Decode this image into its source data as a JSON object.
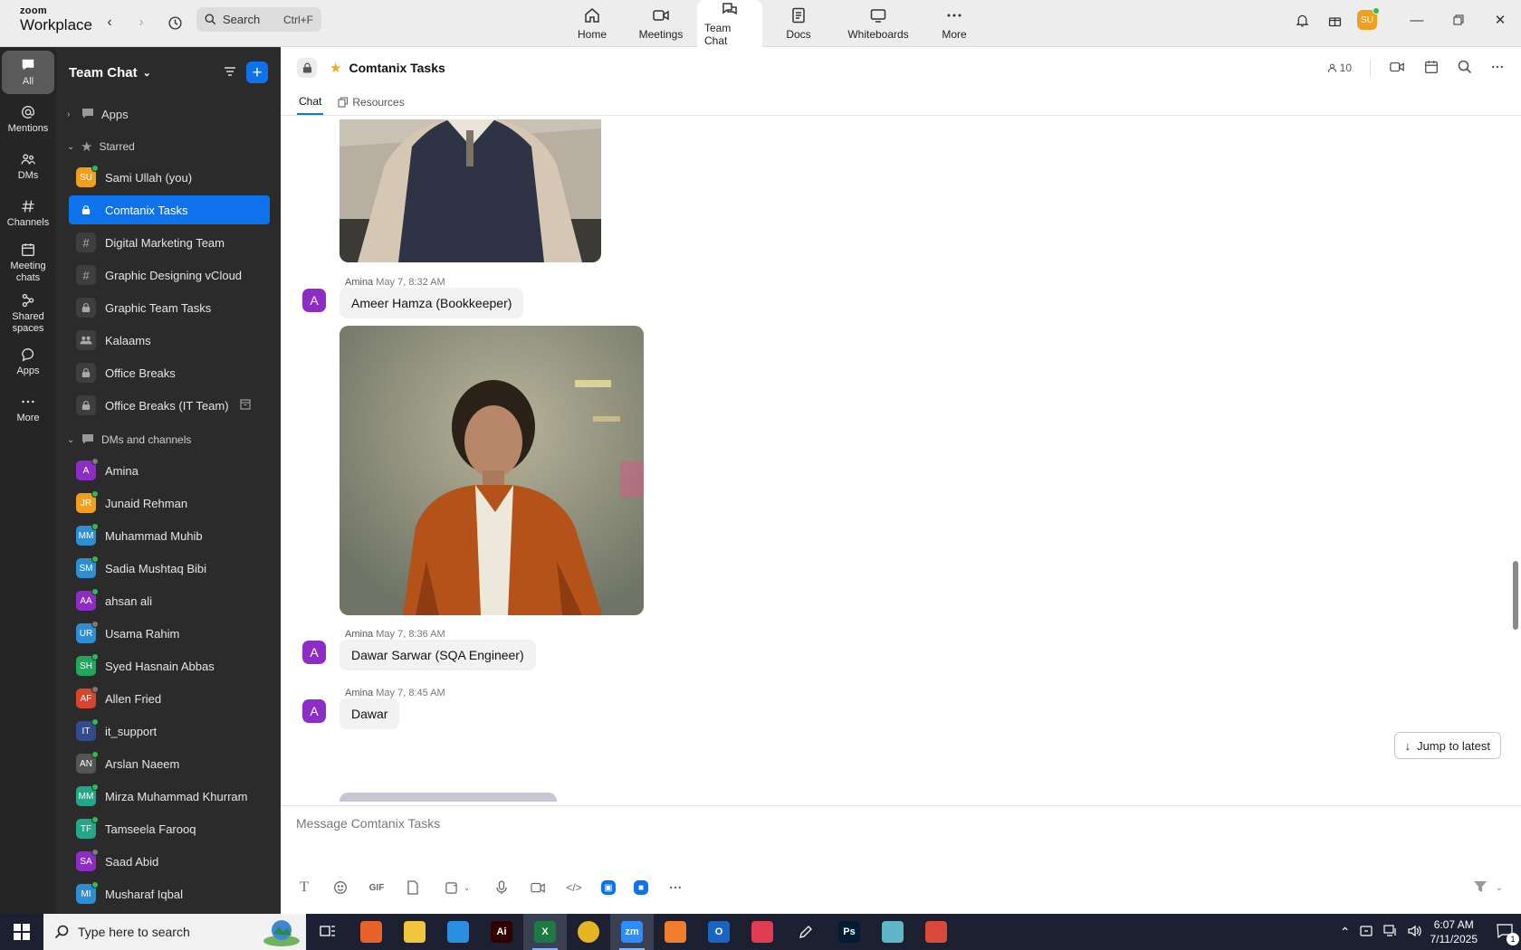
{
  "app": {
    "brand_top": "zoom",
    "brand_bottom": "Workplace"
  },
  "search": {
    "placeholder": "Search",
    "shortcut": "Ctrl+F"
  },
  "nav_tabs": [
    {
      "label": "Home",
      "icon": "home-icon"
    },
    {
      "label": "Meetings",
      "icon": "video-icon"
    },
    {
      "label": "Team Chat",
      "icon": "chat-icon",
      "active": true
    },
    {
      "label": "Docs",
      "icon": "doc-icon"
    },
    {
      "label": "Whiteboards",
      "icon": "whiteboard-icon"
    },
    {
      "label": "More",
      "icon": "more-icon"
    }
  ],
  "user": {
    "initials": "SU",
    "color": "#f0a01c"
  },
  "rail": [
    {
      "label": "All",
      "active": true
    },
    {
      "label": "Mentions"
    },
    {
      "label": "DMs"
    },
    {
      "label": "Channels"
    },
    {
      "label": "Meeting chats"
    },
    {
      "label": "Shared spaces"
    },
    {
      "label": "Apps"
    },
    {
      "label": "More"
    }
  ],
  "sidebar": {
    "title": "Team Chat",
    "sections": {
      "apps": "Apps",
      "starred": "Starred",
      "dms": "DMs and channels"
    },
    "starred": [
      {
        "label": "Sami Ullah (you)",
        "type": "avatar",
        "initials": "SU",
        "color": "#f0a01c",
        "status": "on"
      },
      {
        "label": "Comtanix Tasks",
        "type": "lock",
        "active": true
      },
      {
        "label": "Digital Marketing Team",
        "type": "hash"
      },
      {
        "label": "Graphic Designing vCloud",
        "type": "hash"
      },
      {
        "label": "Graphic Team Tasks",
        "type": "lock"
      },
      {
        "label": "Kalaams",
        "type": "group"
      },
      {
        "label": "Office Breaks",
        "type": "lock"
      },
      {
        "label": "Office Breaks (IT Team)",
        "type": "lock",
        "trail": "archive"
      }
    ],
    "dms": [
      {
        "label": "Amina",
        "initials": "A",
        "color": "#8e2dc5",
        "status": "off"
      },
      {
        "label": "Junaid Rehman",
        "initials": "JR",
        "color": "#f0a01c",
        "status": "on"
      },
      {
        "label": "Muhammad Muhib",
        "initials": "MM",
        "color": "#2d8ed2",
        "status": "on"
      },
      {
        "label": "Sadia Mushtaq Bibi",
        "initials": "SM",
        "color": "#2d8ed2",
        "status": "on"
      },
      {
        "label": "ahsan ali",
        "initials": "AA",
        "color": "#8e2dc5",
        "status": "on"
      },
      {
        "label": "Usama Rahim",
        "initials": "UR",
        "color": "#2d8ed2",
        "status": "off"
      },
      {
        "label": "Syed Hasnain Abbas",
        "initials": "SH",
        "color": "#24a65c",
        "status": "on"
      },
      {
        "label": "Allen Fried",
        "initials": "AF",
        "color": "#d8452a",
        "status": "off"
      },
      {
        "label": "it_support",
        "initials": "IT",
        "color": "#334a8c",
        "status": "on"
      },
      {
        "label": "Arslan Naeem",
        "initials": "AN",
        "color": "#555555",
        "status": "on"
      },
      {
        "label": "Mirza Muhammad Khurram",
        "initials": "MM",
        "color": "#24a68a",
        "status": "on"
      },
      {
        "label": "Tamseela Farooq",
        "initials": "TF",
        "color": "#24a68a",
        "status": "on"
      },
      {
        "label": "Saad Abid",
        "initials": "SA",
        "color": "#8e2dc5",
        "status": "off"
      },
      {
        "label": "Musharaf Iqbal",
        "initials": "MI",
        "color": "#2d8ed2",
        "status": "on"
      }
    ]
  },
  "channel": {
    "name": "Comtanix Tasks",
    "member_count": "10",
    "tabs": {
      "chat": "Chat",
      "resources": "Resources"
    }
  },
  "messages": [
    {
      "sender": "Amina",
      "time": "May 7, 8:32 AM",
      "text": "Ameer Hamza (Bookkeeper)",
      "avatar": "A"
    },
    {
      "sender": "Amina",
      "time": "May 7, 8:36 AM",
      "text": "Dawar Sarwar (SQA Engineer)",
      "avatar": "A"
    },
    {
      "sender": "Amina",
      "time": "May 7, 8:45 AM",
      "text": "Dawar",
      "avatar": "A"
    }
  ],
  "jump_label": "Jump to latest",
  "composer": {
    "placeholder": "Message Comtanix Tasks",
    "gif": "GIF"
  },
  "taskbar": {
    "search_placeholder": "Type here to search",
    "time": "6:07 AM",
    "date": "7/11/2025",
    "notif_count": "1",
    "apps": [
      {
        "name": "task-view",
        "label": ""
      },
      {
        "name": "firefox",
        "label": ""
      },
      {
        "name": "file-explorer",
        "label": ""
      },
      {
        "name": "vscode",
        "label": ""
      },
      {
        "name": "illustrator",
        "label": "Ai"
      },
      {
        "name": "excel",
        "label": "X"
      },
      {
        "name": "chrome",
        "label": ""
      },
      {
        "name": "zoom",
        "label": "zm"
      },
      {
        "name": "xampp",
        "label": ""
      },
      {
        "name": "outlook",
        "label": "O"
      },
      {
        "name": "creative-cloud",
        "label": ""
      },
      {
        "name": "pen-tool",
        "label": ""
      },
      {
        "name": "photoshop",
        "label": "Ps"
      },
      {
        "name": "app-diamond",
        "label": ""
      },
      {
        "name": "app-tool",
        "label": ""
      }
    ]
  }
}
